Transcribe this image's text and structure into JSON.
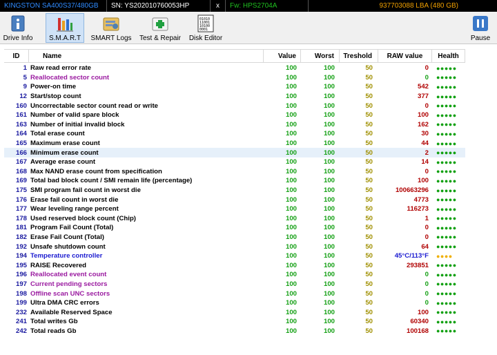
{
  "titlebar": {
    "model": "KINGSTON SA400S37/480GB",
    "serial": "SN: YS202010760053HP",
    "close": "x",
    "firmware": "Fw: HPS2704A",
    "capacity": "937703088 LBA (480 GB)"
  },
  "toolbar": {
    "drive_info": "Drive Info",
    "smart": "S.M.A.R.T",
    "smart_logs": "SMART Logs",
    "test_repair": "Test & Repair",
    "disk_editor": "Disk Editor",
    "pause": "Pause"
  },
  "columns": {
    "id": "ID",
    "name": "Name",
    "value": "Value",
    "worst": "Worst",
    "threshold": "Treshold",
    "raw": "RAW value",
    "health": "Health"
  },
  "colors": {
    "id": "#1a1aa0",
    "value_green": "#14a014",
    "threshold": "#a09000",
    "raw_red": "#b00000",
    "name_purple": "#9a1aa0",
    "name_blue": "#1a1ad0",
    "health_good": "#10a010",
    "health_warn": "#f0b000"
  },
  "rows": [
    {
      "id": "1",
      "name": "Raw read error rate",
      "value": "100",
      "worst": "100",
      "threshold": "50",
      "raw": "0",
      "health": "●●●●●",
      "name_style": "black",
      "raw_style": "red",
      "health_style": "good"
    },
    {
      "id": "5",
      "name": "Reallocated sector count",
      "value": "100",
      "worst": "100",
      "threshold": "50",
      "raw": "0",
      "health": "●●●●●",
      "name_style": "purple",
      "raw_style": "green",
      "health_style": "good"
    },
    {
      "id": "9",
      "name": "Power-on time",
      "value": "100",
      "worst": "100",
      "threshold": "50",
      "raw": "542",
      "health": "●●●●●",
      "name_style": "black",
      "raw_style": "red",
      "health_style": "good"
    },
    {
      "id": "12",
      "name": "Start/stop count",
      "value": "100",
      "worst": "100",
      "threshold": "50",
      "raw": "377",
      "health": "●●●●●",
      "name_style": "black",
      "raw_style": "red",
      "health_style": "good"
    },
    {
      "id": "160",
      "name": "Uncorrectable sector count read or write",
      "value": "100",
      "worst": "100",
      "threshold": "50",
      "raw": "0",
      "health": "●●●●●",
      "name_style": "black",
      "raw_style": "red",
      "health_style": "good"
    },
    {
      "id": "161",
      "name": "Number of valid spare block",
      "value": "100",
      "worst": "100",
      "threshold": "50",
      "raw": "100",
      "health": "●●●●●",
      "name_style": "black",
      "raw_style": "red",
      "health_style": "good"
    },
    {
      "id": "163",
      "name": "Number of initial invalid block",
      "value": "100",
      "worst": "100",
      "threshold": "50",
      "raw": "162",
      "health": "●●●●●",
      "name_style": "black",
      "raw_style": "red",
      "health_style": "good"
    },
    {
      "id": "164",
      "name": "Total erase count",
      "value": "100",
      "worst": "100",
      "threshold": "50",
      "raw": "30",
      "health": "●●●●●",
      "name_style": "black",
      "raw_style": "red",
      "health_style": "good"
    },
    {
      "id": "165",
      "name": "Maximum erase count",
      "value": "100",
      "worst": "100",
      "threshold": "50",
      "raw": "44",
      "health": "●●●●●",
      "name_style": "black",
      "raw_style": "red",
      "health_style": "good"
    },
    {
      "id": "166",
      "name": "Minimum erase count",
      "value": "100",
      "worst": "100",
      "threshold": "50",
      "raw": "2",
      "health": "●●●●●",
      "name_style": "black",
      "raw_style": "red",
      "health_style": "good",
      "selected": true
    },
    {
      "id": "167",
      "name": "Average erase count",
      "value": "100",
      "worst": "100",
      "threshold": "50",
      "raw": "14",
      "health": "●●●●●",
      "name_style": "black",
      "raw_style": "red",
      "health_style": "good"
    },
    {
      "id": "168",
      "name": "Max NAND erase count from specification",
      "value": "100",
      "worst": "100",
      "threshold": "50",
      "raw": "0",
      "health": "●●●●●",
      "name_style": "black",
      "raw_style": "red",
      "health_style": "good"
    },
    {
      "id": "169",
      "name": "Total bad block count / SMI remain life (percentage)",
      "value": "100",
      "worst": "100",
      "threshold": "50",
      "raw": "100",
      "health": "●●●●●",
      "name_style": "black",
      "raw_style": "red",
      "health_style": "good"
    },
    {
      "id": "175",
      "name": "SMI program fail count in worst die",
      "value": "100",
      "worst": "100",
      "threshold": "50",
      "raw": "100663296",
      "health": "●●●●●",
      "name_style": "black",
      "raw_style": "red",
      "health_style": "good"
    },
    {
      "id": "176",
      "name": "Erase fail count in worst die",
      "value": "100",
      "worst": "100",
      "threshold": "50",
      "raw": "4773",
      "health": "●●●●●",
      "name_style": "black",
      "raw_style": "red",
      "health_style": "good"
    },
    {
      "id": "177",
      "name": "Wear leveling range percent",
      "value": "100",
      "worst": "100",
      "threshold": "50",
      "raw": "116273",
      "health": "●●●●●",
      "name_style": "black",
      "raw_style": "red",
      "health_style": "good"
    },
    {
      "id": "178",
      "name": "Used reserved block count (Chip)",
      "value": "100",
      "worst": "100",
      "threshold": "50",
      "raw": "1",
      "health": "●●●●●",
      "name_style": "black",
      "raw_style": "red",
      "health_style": "good"
    },
    {
      "id": "181",
      "name": "Program Fail Count (Total)",
      "value": "100",
      "worst": "100",
      "threshold": "50",
      "raw": "0",
      "health": "●●●●●",
      "name_style": "black",
      "raw_style": "red",
      "health_style": "good"
    },
    {
      "id": "182",
      "name": "Erase Fail Count (Total)",
      "value": "100",
      "worst": "100",
      "threshold": "50",
      "raw": "0",
      "health": "●●●●●",
      "name_style": "black",
      "raw_style": "red",
      "health_style": "good"
    },
    {
      "id": "192",
      "name": "Unsafe shutdown count",
      "value": "100",
      "worst": "100",
      "threshold": "50",
      "raw": "64",
      "health": "●●●●●",
      "name_style": "black",
      "raw_style": "red",
      "health_style": "good"
    },
    {
      "id": "194",
      "name": "Temperature controller",
      "value": "100",
      "worst": "100",
      "threshold": "50",
      "raw": "45°C/113°F",
      "health": "●●●●",
      "name_style": "blue",
      "raw_style": "blue",
      "health_style": "warn"
    },
    {
      "id": "195",
      "name": "RAISE Recovered",
      "value": "100",
      "worst": "100",
      "threshold": "50",
      "raw": "293851",
      "health": "●●●●●",
      "name_style": "black",
      "raw_style": "red",
      "health_style": "good"
    },
    {
      "id": "196",
      "name": "Reallocated event count",
      "value": "100",
      "worst": "100",
      "threshold": "50",
      "raw": "0",
      "health": "●●●●●",
      "name_style": "purple",
      "raw_style": "green",
      "health_style": "good"
    },
    {
      "id": "197",
      "name": "Current pending sectors",
      "value": "100",
      "worst": "100",
      "threshold": "50",
      "raw": "0",
      "health": "●●●●●",
      "name_style": "purple",
      "raw_style": "green",
      "health_style": "good"
    },
    {
      "id": "198",
      "name": "Offline scan UNC sectors",
      "value": "100",
      "worst": "100",
      "threshold": "50",
      "raw": "0",
      "health": "●●●●●",
      "name_style": "purple",
      "raw_style": "green",
      "health_style": "good"
    },
    {
      "id": "199",
      "name": "Ultra DMA CRC errors",
      "value": "100",
      "worst": "100",
      "threshold": "50",
      "raw": "0",
      "health": "●●●●●",
      "name_style": "black",
      "raw_style": "green",
      "health_style": "good"
    },
    {
      "id": "232",
      "name": "Available Reserved Space",
      "value": "100",
      "worst": "100",
      "threshold": "50",
      "raw": "100",
      "health": "●●●●●",
      "name_style": "black",
      "raw_style": "red",
      "health_style": "good"
    },
    {
      "id": "241",
      "name": "Total writes Gb",
      "value": "100",
      "worst": "100",
      "threshold": "50",
      "raw": "60340",
      "health": "●●●●●",
      "name_style": "black",
      "raw_style": "red",
      "health_style": "good"
    },
    {
      "id": "242",
      "name": "Total reads Gb",
      "value": "100",
      "worst": "100",
      "threshold": "50",
      "raw": "100168",
      "health": "●●●●●",
      "name_style": "black",
      "raw_style": "red",
      "health_style": "good"
    }
  ]
}
